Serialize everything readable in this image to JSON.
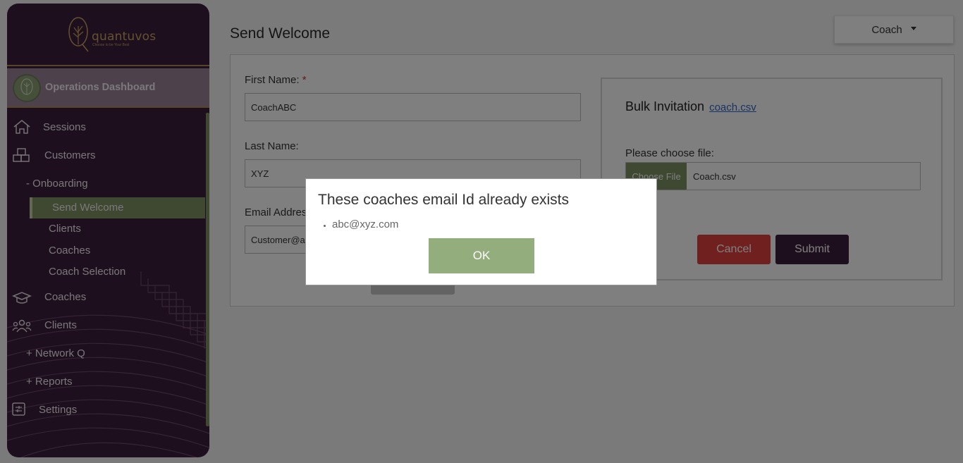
{
  "brand": {
    "name": "quantuvos",
    "tagline": "Choose to be Your Best"
  },
  "sidebar": {
    "dashboard_label": "Operations Dashboard",
    "items": [
      {
        "label": "Sessions",
        "icon": "home-icon"
      },
      {
        "label": "Customers",
        "icon": "boxes-icon"
      },
      {
        "label": "- Onboarding"
      },
      {
        "label": "Send Welcome"
      },
      {
        "label": "Clients"
      },
      {
        "label": "Coaches"
      },
      {
        "label": "Coach Selection"
      },
      {
        "label": "Coaches",
        "icon": "graduation-cap-icon"
      },
      {
        "label": "Clients",
        "icon": "users-icon"
      },
      {
        "label": "+ Network Q"
      },
      {
        "label": "+ Reports"
      },
      {
        "label": "Settings",
        "icon": "settings-icon"
      }
    ]
  },
  "header": {
    "page_title": "Send Welcome",
    "role_dropdown": "Coach"
  },
  "form": {
    "first_name_label": "First Name:",
    "required_mark": "*",
    "first_name_value": "CoachABC",
    "last_name_label": "Last Name:",
    "last_name_value": "XYZ",
    "email_label": "Email Address:",
    "email_value": "Customer@abc.com"
  },
  "bulk": {
    "title": "Bulk Invitation",
    "template_link": "coach.csv",
    "choose_label": "Please choose file:",
    "choose_button": "Choose File",
    "file_name": "Coach.csv",
    "cancel_label": "Cancel",
    "submit_label": "Submit"
  },
  "modal": {
    "title": "These coaches email Id already exists",
    "emails": [
      "abc@xyz.com"
    ],
    "ok_label": "OK"
  },
  "colors": {
    "sidebar_bg": "#3d1e3c",
    "accent_green": "#7f9161",
    "gold": "#c9a45c",
    "cancel_red": "#e0413f",
    "submit_purple": "#3d1e3c"
  }
}
